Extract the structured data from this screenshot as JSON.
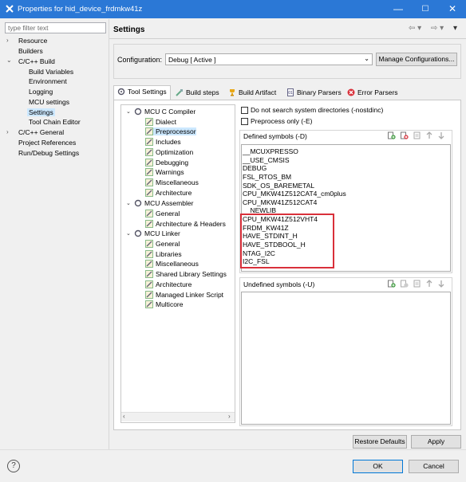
{
  "window": {
    "title": "Properties for hid_device_frdmkw41z",
    "min": "—",
    "max": "☐",
    "close": "✕"
  },
  "nav": {
    "filter_placeholder": "type filter text",
    "items": [
      "Resource",
      "Builders",
      "C/C++ Build",
      "Build Variables",
      "Environment",
      "Logging",
      "MCU settings",
      "Settings",
      "Tool Chain Editor",
      "C/C++ General",
      "Project References",
      "Run/Debug Settings"
    ]
  },
  "page": {
    "title": "Settings"
  },
  "config": {
    "label": "Configuration:",
    "value": "Debug  [ Active ]",
    "manage": "Manage Configurations..."
  },
  "tabs": [
    "Tool Settings",
    "Build steps",
    "Build Artifact",
    "Binary Parsers",
    "Error Parsers"
  ],
  "tree": {
    "compiler": "MCU C Compiler",
    "compiler_items": [
      "Dialect",
      "Preprocessor",
      "Includes",
      "Optimization",
      "Debugging",
      "Warnings",
      "Miscellaneous",
      "Architecture"
    ],
    "assembler": "MCU Assembler",
    "assembler_items": [
      "General",
      "Architecture & Headers"
    ],
    "linker": "MCU Linker",
    "linker_items": [
      "General",
      "Libraries",
      "Miscellaneous",
      "Shared Library Settings",
      "Architecture",
      "Managed Linker Script",
      "Multicore"
    ]
  },
  "options": {
    "nostdinc": "Do not search system directories (-nostdinc)",
    "preprocess_only": "Preprocess only (-E)"
  },
  "defined": {
    "label": "Defined symbols (-D)",
    "symbols": [
      "__MCUXPRESSO",
      "__USE_CMSIS",
      "DEBUG",
      "FSL_RTOS_BM",
      "SDK_OS_BAREMETAL",
      "CPU_MKW41Z512CAT4_cm0plus",
      "CPU_MKW41Z512CAT4",
      "__NEWLIB__",
      "CPU_MKW41Z512VHT4",
      "FRDM_KW41Z",
      "HAVE_STDINT_H",
      "HAVE_STDBOOL_H",
      "NTAG_I2C",
      "I2C_FSL"
    ]
  },
  "undefined": {
    "label": "Undefined symbols (-U)"
  },
  "buttons": {
    "restore": "Restore Defaults",
    "apply": "Apply",
    "ok": "OK",
    "cancel": "Cancel",
    "help": "?"
  },
  "colors": {
    "titlebar": "#2b78d6",
    "highlight": "#d9303a",
    "selection": "#cce8ff"
  }
}
